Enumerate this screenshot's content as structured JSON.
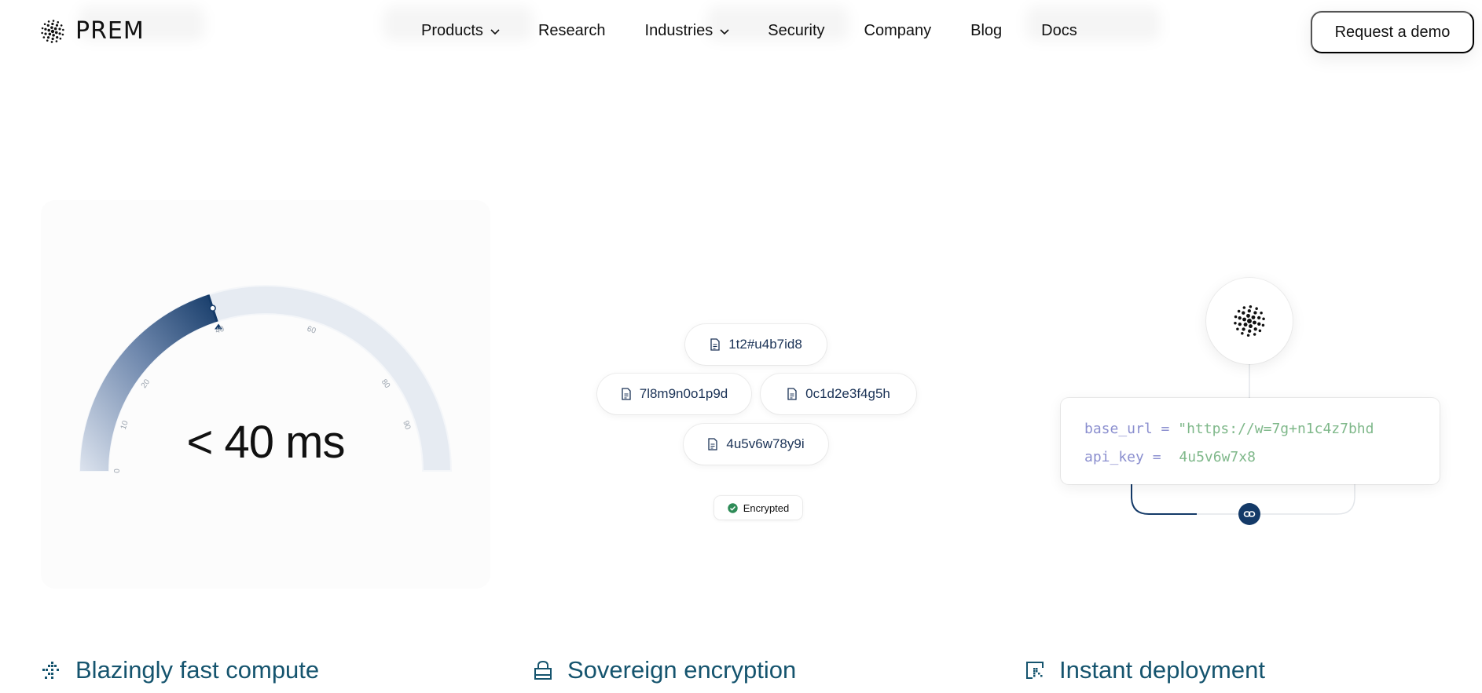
{
  "nav": {
    "brand": "PREM",
    "links": [
      {
        "label": "Products",
        "dropdown": true
      },
      {
        "label": "Research",
        "dropdown": false
      },
      {
        "label": "Industries",
        "dropdown": true
      },
      {
        "label": "Security",
        "dropdown": false
      },
      {
        "label": "Company",
        "dropdown": false
      },
      {
        "label": "Blog",
        "dropdown": false
      },
      {
        "label": "Docs",
        "dropdown": false
      }
    ],
    "cta": "Request a demo"
  },
  "speed": {
    "label": "< 40 ms",
    "gauge_value": 40,
    "gauge_max": 100,
    "ticks": [
      "0",
      "10",
      "20",
      "40",
      "60",
      "80",
      "90"
    ],
    "accent": "#143a68"
  },
  "encryption": {
    "tokens": [
      "1t2#u4b7id8",
      "7l8m9n0o1p9d",
      "0c1d2e3f4g5h",
      "4u5v6w78y9i"
    ],
    "badge": "Encrypted",
    "badge_color": "#2e8b57"
  },
  "deploy": {
    "code": [
      {
        "key": "base_url",
        "op": "=",
        "value": "\"https://w=7g+n1c4z7bhd"
      },
      {
        "key": "api_key",
        "op": "=",
        "value": "4u5v6w7x8"
      }
    ],
    "icon": "link-icon"
  },
  "features": [
    {
      "title": "Blazingly fast compute",
      "icon": "speed-grid-icon"
    },
    {
      "title": "Sovereign encryption",
      "icon": "lock-icon"
    },
    {
      "title": "Instant deployment",
      "icon": "cursor-box-icon"
    }
  ]
}
